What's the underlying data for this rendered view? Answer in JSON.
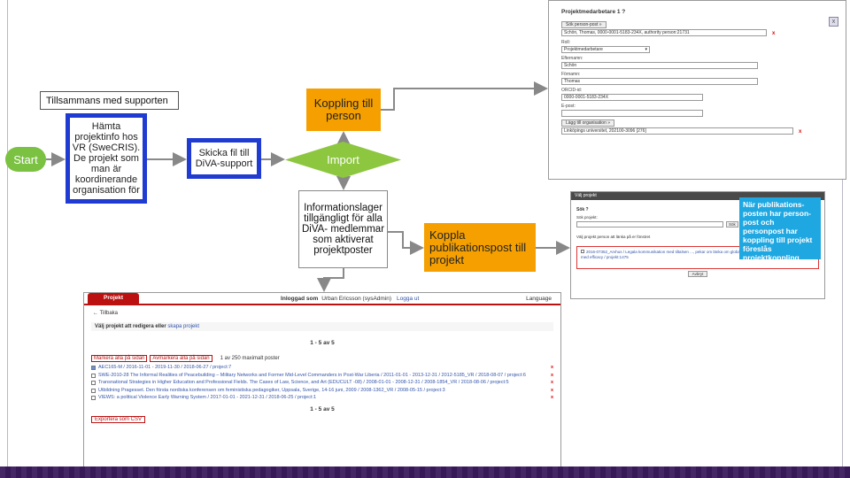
{
  "flow": {
    "start": "Start",
    "hamta": "Hämta projektinfo hos VR (SweCRIS). De projekt som man är koordinerande organisation för",
    "tillsammans": "Tillsammans med supporten",
    "skicka": "Skicka fil till DiVA-support",
    "import": "Import",
    "koppling": "Koppling till person",
    "info": "Informationslager tillgängligt för alla DiVA- medlemmar som aktiverat projektposter",
    "koppla": "Koppla publikationspost till projekt",
    "callout": "När publikations-posten har person-post och personpost har koppling till projekt föreslås projektkoppling"
  },
  "top_screenshot": {
    "title": "Projektmedarbetare 1 ?",
    "sok_button": "Sök person-post »",
    "person_value": "Schön, Thomas, 0000-0001-5183-234X, authority person:21731",
    "roll_label": "Roll:",
    "roll_value": "Projektmedarbetare",
    "efternamn_label": "Efternamn:",
    "efternamn_value": "Schön",
    "fornamn_label": "Förnamn:",
    "fornamn_value": "Thomas",
    "orcid_label": "ORCID-id:",
    "orcid_value": "0000-0001-5183-234X",
    "epost_label": "E-post:",
    "lagg_button": "Lägg till organisation »",
    "org_value": "Linköpings universitet, 202100-3096 [276]",
    "remove": "x",
    "close": "x"
  },
  "mid_screenshot": {
    "head": "Välj projekt",
    "sok_label": "Sök ?",
    "sok_projekt": "Sök projekt:",
    "sok_btn": "Sök",
    "hint": "Välj projekt person att länka på er fönstret",
    "suggestion": "2016-07352_Arvhus / Legala kommunikation med tiltalsen ..., pekar om länka om globala mätprojektion / ansvarsos, copyright med efficacy / projekt:1475",
    "avbryt": "Avbryt"
  },
  "bottom_screenshot": {
    "tab": "Projekt",
    "logged": "Inloggad som",
    "user": "Urban Ericsson (sysAdmin)",
    "logout": "Logga ut",
    "language": "Language",
    "back": "Tillbaka",
    "choose": "Välj projekt att redigera eller",
    "create": "skapa projekt",
    "paging": "1 - 5 av 5",
    "mark_all": "Markera alla på sidan",
    "unmark_all": "Avmarkera alla på sidan",
    "selected": "1 av 250 maximalt poster",
    "rows": [
      "AEC165-M / 2016-11-01 - 2019-11-30 / 2018-06-27 / project:7",
      "SWE-2010-28 The Informal Realities of Peacebuilding – Military Networks and Former Mid-Level Commanders in Post-War Liberia / 2011-01-01 - 2013-12-31 / 2012-5185_VR / 2018-08-07 / project:6",
      "Transnational Strategies in Higher Education and Professional Fields. The Cases of Law, Science, and Art (EDUCULT -08) / 2008-01-01 - 2008-12-31 / 2008-1854_VR / 2018-08-06 / project:5",
      "Utbildning Pragesset. Den första nordiska konferensen om feministiska pedagogiker, Uppsala, Sverige, 14-16 juni, 2009 / 2008-1362_VR / 2008-05-15 / project:3",
      "VIEWS: a political Violence Early Warning System / 2017-01-01 - 2021-12-31 / 2018-06-25 / project:1"
    ],
    "paging2": "1 - 5 av 5",
    "export": "Exportera som CSV",
    "remove": "x"
  }
}
